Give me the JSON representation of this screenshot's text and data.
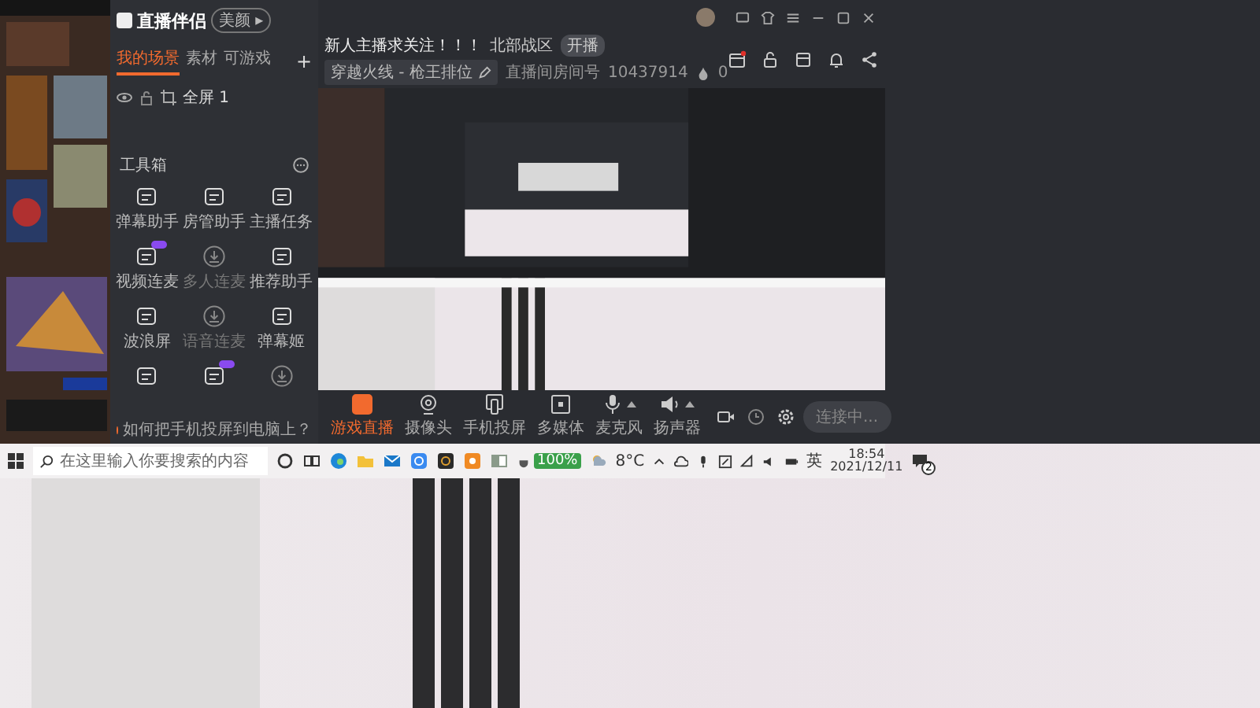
{
  "app": {
    "logo": "直播伴侣",
    "logo_button": "美颜 ▸"
  },
  "sidebar": {
    "tabs": [
      {
        "label": "我的场景",
        "selected": true
      },
      {
        "label": "素材",
        "selected": false
      },
      {
        "label": "可游戏",
        "selected": false
      }
    ],
    "add_tab": "+",
    "scene": {
      "label": "全屏 1",
      "visible": true
    },
    "toolbox": {
      "title": "工具箱",
      "items": [
        {
          "label": "弹幕助手",
          "disabled": false,
          "badge": false
        },
        {
          "label": "房管助手",
          "disabled": false,
          "badge": false
        },
        {
          "label": "主播任务",
          "disabled": false,
          "badge": false
        },
        {
          "label": "视频连麦",
          "disabled": false,
          "badge": true
        },
        {
          "label": "多人连麦",
          "disabled": true,
          "badge": false
        },
        {
          "label": "推荐助手",
          "disabled": false,
          "badge": false
        },
        {
          "label": "波浪屏",
          "disabled": false,
          "badge": false
        },
        {
          "label": "语音连麦",
          "disabled": true,
          "badge": false
        },
        {
          "label": "弹幕姬",
          "disabled": false,
          "badge": false
        },
        {
          "disabled": false,
          "badge": false
        },
        {
          "disabled": false,
          "badge": true
        },
        {
          "disabled": true,
          "badge": false
        }
      ]
    },
    "notice": "如何把手机投屏到电脑上？"
  },
  "header": {
    "title": "新人主播求关注！！！",
    "zone": "北部战区",
    "tag": "开播",
    "category": "穿越火线 - 枪王排位",
    "id_label": "直播间房间号",
    "room_id": "10437914",
    "heat": "0"
  },
  "toolbar": {
    "items": [
      {
        "kind": "screen",
        "label": "游戏直播",
        "selected": true,
        "caret": false
      },
      {
        "kind": "camera",
        "label": "摄像头",
        "selected": false,
        "caret": false
      },
      {
        "kind": "phone",
        "label": "手机投屏",
        "selected": false,
        "caret": false
      },
      {
        "kind": "media",
        "label": "多媒体",
        "selected": false,
        "caret": false
      },
      {
        "kind": "mic",
        "label": "麦克风",
        "selected": false,
        "caret": true
      },
      {
        "kind": "speaker",
        "label": "扬声器",
        "selected": false,
        "caret": true
      }
    ],
    "start_button": "连接中..."
  },
  "taskbar": {
    "search_placeholder": "在这里输入你要搜索的内容",
    "battery": "100%",
    "weather": "8°C",
    "ime": "英",
    "time": "18:54",
    "date": "2021/12/11",
    "notifications": "2"
  }
}
